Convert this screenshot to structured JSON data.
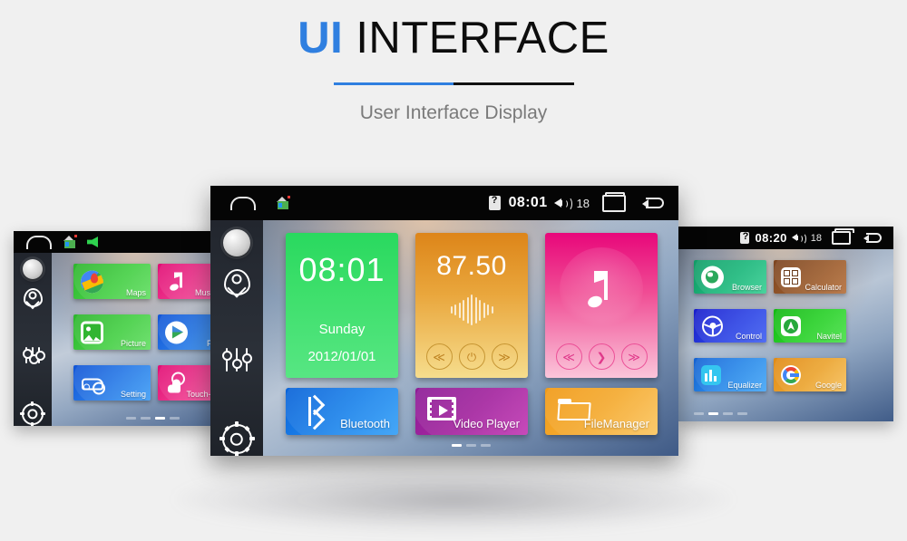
{
  "header": {
    "title_accent": "UI",
    "title_rest": " INTERFACE",
    "subtitle": "User Interface Display",
    "accent_color": "#2f7fe0",
    "rule_dark_color": "#111111"
  },
  "center_device": {
    "statusbar": {
      "home_icon": "home-icon",
      "launcher_icon": "house-app-icon",
      "sim_icon": "sim-card-icon",
      "time": "08:01",
      "volume_icon": "speaker-icon",
      "volume_level": "18",
      "recents_icon": "recent-apps-icon",
      "back_icon": "back-arrow-icon"
    },
    "sidebar": {
      "knob": "rotary-knob",
      "items": [
        {
          "name": "location-pin-icon"
        },
        {
          "name": "equalizer-icon"
        },
        {
          "name": "settings-gear-icon"
        }
      ]
    },
    "widgets": {
      "clock": {
        "time": "08:01",
        "day": "Sunday",
        "date": "2012/01/01",
        "color": "#3ddf6b"
      },
      "radio": {
        "frequency": "87.50",
        "prev_icon": "prev-track-icon",
        "power_icon": "power-icon",
        "next_icon": "next-track-icon",
        "color": "#e9a63c"
      },
      "music": {
        "note_icon": "music-note-icon",
        "prev_icon": "prev-track-icon",
        "play_icon": "play-icon",
        "next_icon": "next-track-icon",
        "color": "#f04e95"
      }
    },
    "tiles": [
      {
        "label": "Bluetooth",
        "icon": "bluetooth-icon",
        "color": "#1f86ec"
      },
      {
        "label": "Video Player",
        "icon": "video-player-icon",
        "color": "#a3269f"
      },
      {
        "label": "FileManager",
        "icon": "folder-icon",
        "color": "#f5ab31"
      }
    ],
    "page_dots": {
      "count": 3,
      "active": 0
    }
  },
  "left_device": {
    "statusbar": {
      "home_icon": "home-icon",
      "launcher_icon": "house-app-icon",
      "signal_icon": "green-indicator-icon"
    },
    "sidebar": {
      "knob": "rotary-knob",
      "items": [
        {
          "name": "location-pin-icon"
        },
        {
          "name": "equalizer-icon"
        },
        {
          "name": "settings-gear-icon"
        }
      ]
    },
    "apps": [
      {
        "label": "Maps",
        "icon": "maps-icon",
        "color": "#45cf45"
      },
      {
        "label": "Music Pla",
        "icon": "music-note-icon",
        "color": "#ef3d90"
      },
      {
        "label": "Picture",
        "icon": "gallery-icon",
        "color": "#45cf45"
      },
      {
        "label": "Play S",
        "icon": "play-store-icon",
        "color": "#2a7de8"
      },
      {
        "label": "Setting",
        "icon": "car-setting-icon",
        "color": "#2a7de8"
      },
      {
        "label": "Touch-Assis",
        "icon": "touch-assistant-icon",
        "color": "#ef3d90"
      }
    ],
    "page_dots": {
      "count": 4,
      "active": 2
    }
  },
  "right_device": {
    "statusbar": {
      "sim_icon": "sim-card-icon",
      "time": "08:20",
      "volume_icon": "speaker-icon",
      "volume_level": "18",
      "recents_icon": "recent-apps-icon",
      "back_icon": "back-arrow-icon"
    },
    "apps": [
      {
        "label": "Browser",
        "icon": "globe-icon",
        "color": "#1db87c"
      },
      {
        "label": "Calculator",
        "icon": "calculator-icon",
        "color": "#9a5b2c"
      },
      {
        "label": "Control",
        "icon": "steering-wheel-icon",
        "color": "#2d44e4"
      },
      {
        "label": "Navitel",
        "icon": "navitel-icon",
        "color": "#2bd22b"
      },
      {
        "label": "Equalizer",
        "icon": "equalizer-bars-icon",
        "color": "#2b8bea"
      },
      {
        "label": "Google",
        "icon": "google-g-icon",
        "color": "#eca530"
      }
    ],
    "page_dots": {
      "count": 4,
      "active": 1
    }
  }
}
